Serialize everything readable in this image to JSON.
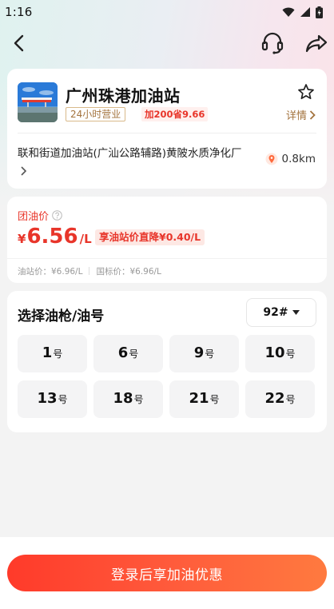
{
  "status_bar": {
    "time": "1:16"
  },
  "station": {
    "name": "广州珠港加油站",
    "hours_tag": "24小时营业",
    "save_tag": "加200省9.66",
    "details_label": "详情",
    "address": "联和街道加油站(广汕公路辅路)黄陂水质净化厂",
    "distance": "0.8km"
  },
  "price": {
    "group_label": "团油价",
    "currency": "¥",
    "value": "6.56",
    "unit": "/L",
    "promo": "享油站价直降¥0.40/L",
    "station_price": "油站价：¥6.96/L",
    "national_price": "国标价：¥6.96/L"
  },
  "selector": {
    "title": "选择油枪/油号",
    "oil_type": "92#",
    "guns": [
      {
        "num": "1",
        "suffix": "号"
      },
      {
        "num": "6",
        "suffix": "号"
      },
      {
        "num": "9",
        "suffix": "号"
      },
      {
        "num": "10",
        "suffix": "号"
      },
      {
        "num": "13",
        "suffix": "号"
      },
      {
        "num": "18",
        "suffix": "号"
      },
      {
        "num": "21",
        "suffix": "号"
      },
      {
        "num": "22",
        "suffix": "号"
      }
    ]
  },
  "footer": {
    "login_label": "登录后享加油优惠"
  },
  "colors": {
    "accent_red": "#e8352a",
    "gold": "#a3733d",
    "button_gradient_start": "#ff3a2a",
    "button_gradient_end": "#ff7a3f"
  }
}
